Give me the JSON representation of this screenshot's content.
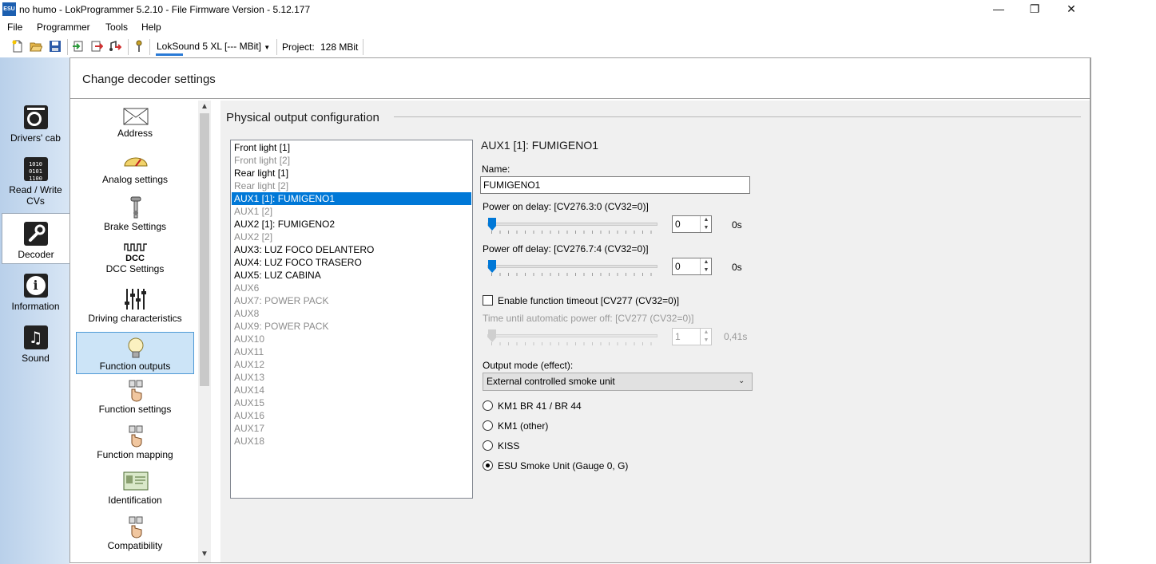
{
  "window": {
    "title": "no humo - LokProgrammer 5.2.10 - File Firmware Version - 5.12.177",
    "app_icon_text": "ESU",
    "minimize": "—",
    "restore": "❐",
    "close": "✕"
  },
  "menu": [
    "File",
    "Programmer",
    "Tools",
    "Help"
  ],
  "toolbar": {
    "icons": [
      "new-file-icon",
      "open-folder-icon",
      "save-icon",
      "import-icon",
      "export-icon",
      "sound-export-icon",
      "programmer-key-icon"
    ],
    "decoder_type": "LokSound 5 XL [--- MBit]",
    "project_label": "Project:",
    "project_value": "128 MBit"
  },
  "left_nav": [
    {
      "label": "Drivers' cab",
      "icon": "drivers-cab-icon"
    },
    {
      "label": "Read / Write CVs",
      "icon": "read-write-cv-icon"
    },
    {
      "label": "Decoder",
      "icon": "wrench-icon",
      "active": true
    },
    {
      "label": "Information",
      "icon": "info-icon"
    },
    {
      "label": "Sound",
      "icon": "music-note-icon"
    }
  ],
  "page_heading": "Change decoder settings",
  "categories": [
    {
      "label": "Address",
      "icon": "envelope-icon"
    },
    {
      "label": "Analog settings",
      "icon": "gauge-icon"
    },
    {
      "label": "Brake Settings",
      "icon": "brake-icon"
    },
    {
      "label": "DCC Settings",
      "icon": "dcc-icon",
      "icon_text": "DCC"
    },
    {
      "label": "Driving characteristics",
      "icon": "sliders-icon"
    },
    {
      "label": "Function outputs",
      "icon": "lightbulb-icon",
      "active": true
    },
    {
      "label": "Function settings",
      "icon": "hand-pointer-icon"
    },
    {
      "label": "Function mapping",
      "icon": "hand-pointer-icon"
    },
    {
      "label": "Identification",
      "icon": "id-card-icon"
    },
    {
      "label": "Compatibility",
      "icon": "hand-pointer-icon"
    }
  ],
  "section_title": "Physical output configuration",
  "outputs": [
    {
      "label": "Front light [1]",
      "state": "enabled"
    },
    {
      "label": "Front light [2]",
      "state": "disabled"
    },
    {
      "label": "Rear light [1]",
      "state": "enabled"
    },
    {
      "label": "Rear light [2]",
      "state": "disabled"
    },
    {
      "label": "AUX1 [1]: FUMIGENO1",
      "state": "selected"
    },
    {
      "label": "AUX1 [2]",
      "state": "disabled"
    },
    {
      "label": "AUX2 [1]: FUMIGENO2",
      "state": "enabled"
    },
    {
      "label": "AUX2 [2]",
      "state": "disabled"
    },
    {
      "label": "AUX3: LUZ FOCO DELANTERO",
      "state": "enabled"
    },
    {
      "label": "AUX4: LUZ FOCO TRASERO",
      "state": "enabled"
    },
    {
      "label": "AUX5: LUZ CABINA",
      "state": "enabled"
    },
    {
      "label": "AUX6",
      "state": "disabled"
    },
    {
      "label": "AUX7: POWER PACK",
      "state": "disabled"
    },
    {
      "label": "AUX8",
      "state": "disabled"
    },
    {
      "label": "AUX9: POWER PACK",
      "state": "disabled"
    },
    {
      "label": "AUX10",
      "state": "disabled"
    },
    {
      "label": "AUX11",
      "state": "disabled"
    },
    {
      "label": "AUX12",
      "state": "disabled"
    },
    {
      "label": "AUX13",
      "state": "disabled"
    },
    {
      "label": "AUX14",
      "state": "disabled"
    },
    {
      "label": "AUX15",
      "state": "disabled"
    },
    {
      "label": "AUX16",
      "state": "disabled"
    },
    {
      "label": "AUX17",
      "state": "disabled"
    },
    {
      "label": "AUX18",
      "state": "disabled"
    }
  ],
  "detail": {
    "title": "AUX1 [1]: FUMIGENO1",
    "name_label": "Name:",
    "name_value": "FUMIGENO1",
    "power_on_delay": {
      "label": "Power on delay: [CV276.3:0 (CV32=0)]",
      "value": "0",
      "unit": "0s",
      "level": 0
    },
    "power_off_delay": {
      "label": "Power off delay: [CV276.7:4 (CV32=0)]",
      "value": "0",
      "unit": "0s",
      "level": 0
    },
    "timeout_checkbox": {
      "label": "Enable function timeout [CV277 (CV32=0)]",
      "checked": false
    },
    "auto_power_off": {
      "label": "Time until automatic power off: [CV277 (CV32=0)]",
      "value": "1",
      "unit": "0,41s",
      "level": 0
    },
    "output_mode_label": "Output mode (effect):",
    "output_mode_value": "External controlled smoke unit",
    "radios": [
      {
        "label": "KM1 BR 41 / BR 44",
        "checked": false
      },
      {
        "label": "KM1 (other)",
        "checked": false
      },
      {
        "label": "KISS",
        "checked": false
      },
      {
        "label": "ESU Smoke Unit (Gauge 0, G)",
        "checked": true
      }
    ]
  },
  "colors": {
    "selection": "#0078d7",
    "nav_gradient": "#b9d0ea",
    "active_category": "#cce4f7",
    "panel_bg": "#f0f0f0"
  }
}
